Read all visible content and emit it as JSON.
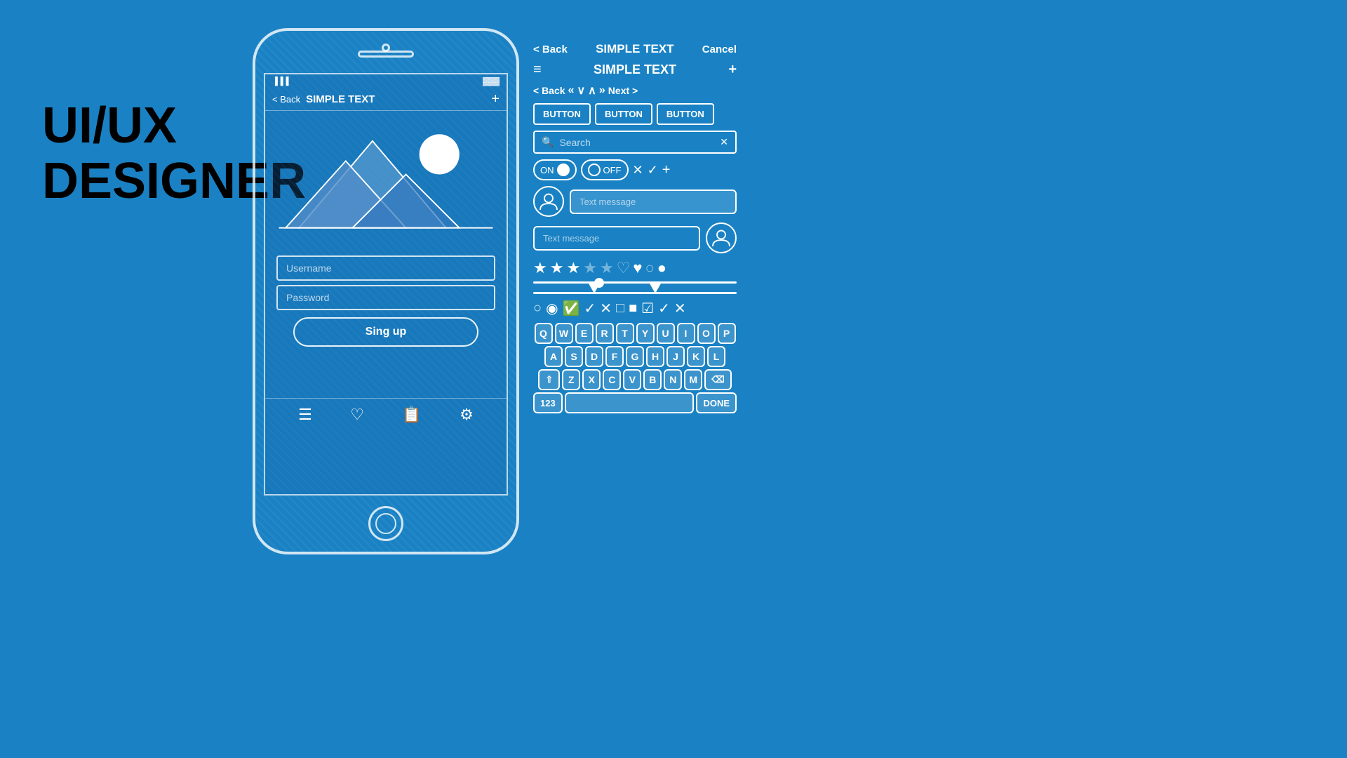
{
  "title": {
    "line1": "UI/UX",
    "line2": "DESIGNER"
  },
  "phone": {
    "status": {
      "signal": "▐▐▐",
      "battery": "▓▓▓"
    },
    "nav": {
      "back": "< Back",
      "title": "SIMPLE TEXT",
      "plus": "+"
    },
    "fields": {
      "username": "Username",
      "password": "Password"
    },
    "button": "Sing up",
    "homeButton": "○"
  },
  "uiPanel": {
    "topNav": {
      "back": "< Back",
      "title": "SIMPLE TEXT",
      "cancel": "Cancel"
    },
    "header": {
      "menu": "≡",
      "title": "SIMPLE TEXT",
      "plus": "+"
    },
    "navRow": {
      "back": "< Back",
      "chevronLeft": "«",
      "chevronDown": "∨",
      "chevronUp": "∧",
      "chevronRight": "»",
      "next": "Next >"
    },
    "buttons": [
      "BUTTON",
      "BUTTON",
      "BUTTON"
    ],
    "search": {
      "placeholder": "Search",
      "clearIcon": "✕"
    },
    "toggleOn": "ON",
    "toggleOff": "OFF",
    "symbols": [
      "✕",
      "✓",
      "+"
    ],
    "messages": {
      "placeholder1": "Text message",
      "placeholder2": "Text message"
    },
    "stars": [
      "★",
      "★",
      "★",
      "☆",
      "☆"
    ],
    "hearts": [
      "♡",
      "♥"
    ],
    "bubbles": [
      "○",
      "●"
    ],
    "keyboard": {
      "row1": [
        "Q",
        "W",
        "E",
        "R",
        "T",
        "Y",
        "U",
        "I",
        "O",
        "P"
      ],
      "row2": [
        "A",
        "S",
        "D",
        "F",
        "G",
        "H",
        "J",
        "K",
        "L"
      ],
      "row3": [
        "⇧",
        "Z",
        "X",
        "C",
        "V",
        "B",
        "N",
        "M",
        "⌫"
      ],
      "row4": {
        "numbers": "123",
        "done": "DONE"
      }
    },
    "checkboxes": [
      "○",
      "◉",
      "✓",
      "✓",
      "✕",
      "□",
      "■",
      "✓",
      "✓",
      "✕"
    ]
  },
  "colors": {
    "background": "#1a82c4",
    "white": "#ffffff",
    "darkText": "#000000"
  }
}
